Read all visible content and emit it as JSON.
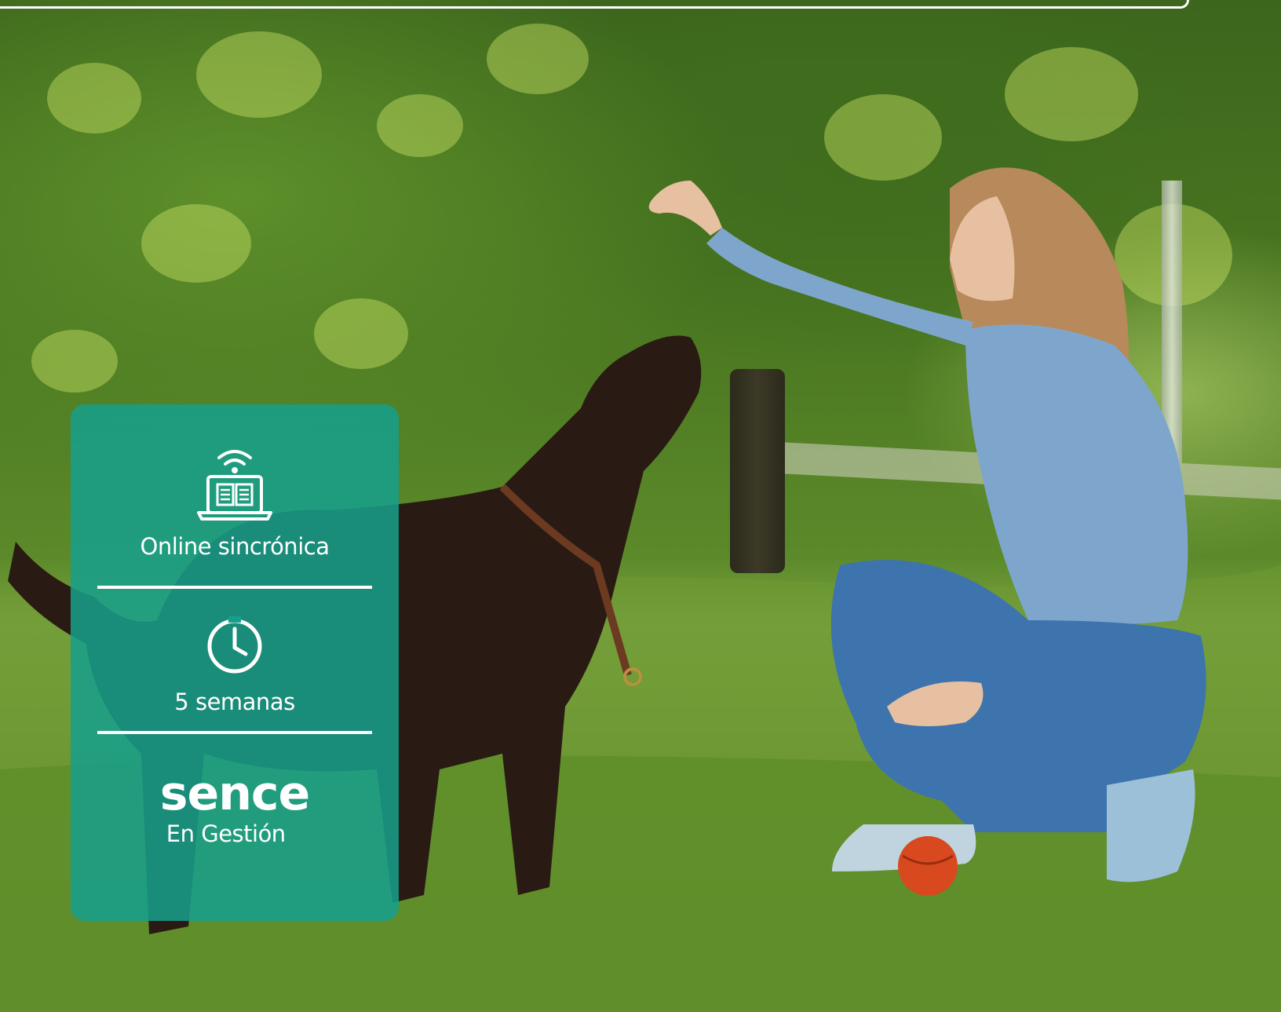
{
  "card": {
    "modality_icon": "laptop-book-wifi-icon",
    "modality": "Online sincrónica",
    "duration_icon": "clock-icon",
    "duration": "5 semanas",
    "logo_text": "sence",
    "logo_status": "En Gestión",
    "accent_color": "#16a08c"
  },
  "photo": {
    "subject": "woman-training-dog-in-park"
  }
}
